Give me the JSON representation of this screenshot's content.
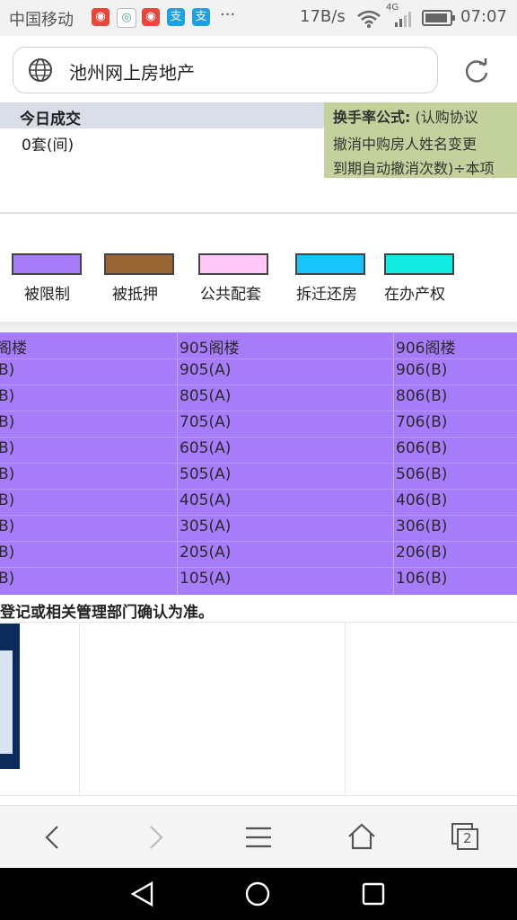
{
  "status_bar": {
    "carrier": "中国移动",
    "net_speed": "17B/s",
    "network": "4G",
    "time": "07:07",
    "more": "···",
    "notif_icons": [
      "weibo-icon",
      "browser-icon",
      "weibo-icon",
      "alipay-icon",
      "alipay-icon"
    ]
  },
  "address_bar": {
    "title": "池州网上房地产"
  },
  "today": {
    "title": "今日成交",
    "value": "0套(间)"
  },
  "formula": {
    "label": "换手率公式:",
    "line1": "(认购协议",
    "line2": "撤消中购房人姓名变更",
    "line3": "到期自动撤消次数)÷本项"
  },
  "legend": [
    {
      "label": "被限制",
      "color": "#a77cfa"
    },
    {
      "label": "被抵押",
      "color": "#9a6534"
    },
    {
      "label": "公共配套",
      "color": "#ffc6f6"
    },
    {
      "label": "拆迁还房",
      "color": "#17c6ff"
    },
    {
      "label": "在办产权",
      "color": "#14ece1"
    }
  ],
  "unit_table": {
    "rows": [
      [
        "阁楼",
        "905阁楼",
        "906阁楼"
      ],
      [
        "B)",
        "905(A)",
        "906(B)"
      ],
      [
        "B)",
        "805(A)",
        "806(B)"
      ],
      [
        "B)",
        "705(A)",
        "706(B)"
      ],
      [
        "B)",
        "605(A)",
        "606(B)"
      ],
      [
        "B)",
        "505(A)",
        "506(B)"
      ],
      [
        "B)",
        "405(A)",
        "406(B)"
      ],
      [
        "B)",
        "305(A)",
        "306(B)"
      ],
      [
        "B)",
        "205(A)",
        "206(B)"
      ],
      [
        "B)",
        "105(A)",
        "106(B)"
      ]
    ]
  },
  "footnote": "登记或相关管理部门确认为准。",
  "toolbar": {
    "tab_count": "2"
  },
  "colors": {
    "accent_purple": "#a77cfa",
    "formula_bg": "#c3d29c",
    "header_bg": "#d9dde7"
  }
}
